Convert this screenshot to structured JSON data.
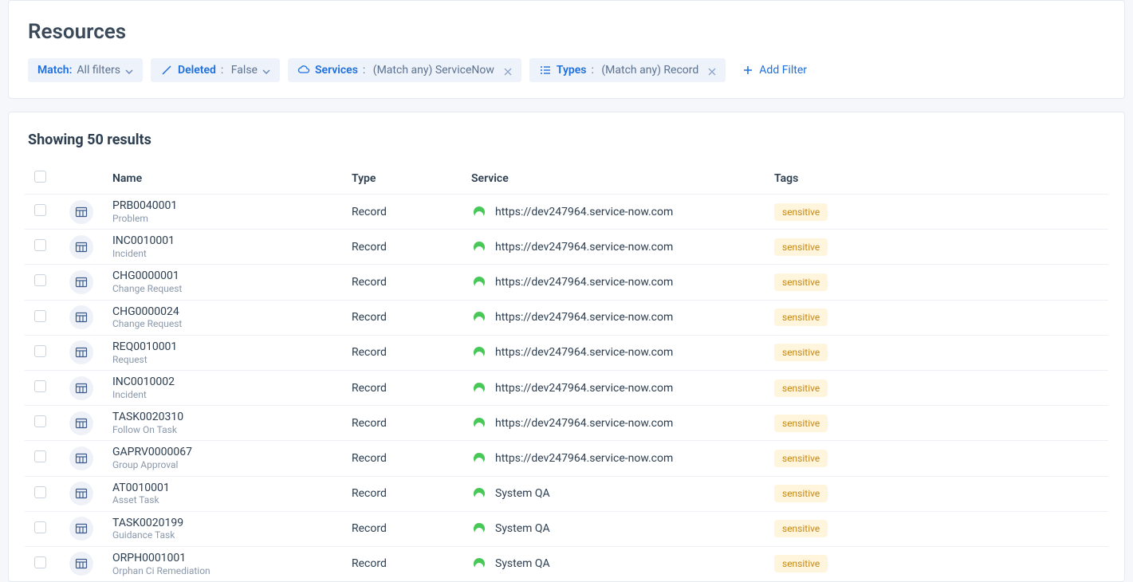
{
  "header": {
    "title": "Resources",
    "filters": {
      "match": {
        "label": "Match:",
        "value": "All filters"
      },
      "deleted": {
        "label": "Deleted",
        "value": "False"
      },
      "services": {
        "label": "Services",
        "value": "(Match any) ServiceNow"
      },
      "types": {
        "label": "Types",
        "value": "(Match any) Record"
      }
    },
    "add_filter_label": "Add Filter"
  },
  "results": {
    "heading": "Showing 50 results",
    "columns": {
      "name": "Name",
      "type": "Type",
      "service": "Service",
      "tags": "Tags"
    },
    "rows": [
      {
        "name": "PRB0040001",
        "sub": "Problem",
        "type": "Record",
        "service": "https://dev247964.service-now.com",
        "tag": "sensitive"
      },
      {
        "name": "INC0010001",
        "sub": "Incident",
        "type": "Record",
        "service": "https://dev247964.service-now.com",
        "tag": "sensitive"
      },
      {
        "name": "CHG0000001",
        "sub": "Change Request",
        "type": "Record",
        "service": "https://dev247964.service-now.com",
        "tag": "sensitive"
      },
      {
        "name": "CHG0000024",
        "sub": "Change Request",
        "type": "Record",
        "service": "https://dev247964.service-now.com",
        "tag": "sensitive"
      },
      {
        "name": "REQ0010001",
        "sub": "Request",
        "type": "Record",
        "service": "https://dev247964.service-now.com",
        "tag": "sensitive"
      },
      {
        "name": "INC0010002",
        "sub": "Incident",
        "type": "Record",
        "service": "https://dev247964.service-now.com",
        "tag": "sensitive"
      },
      {
        "name": "TASK0020310",
        "sub": "Follow On Task",
        "type": "Record",
        "service": "https://dev247964.service-now.com",
        "tag": "sensitive"
      },
      {
        "name": "GAPRV0000067",
        "sub": "Group Approval",
        "type": "Record",
        "service": "https://dev247964.service-now.com",
        "tag": "sensitive"
      },
      {
        "name": "AT0010001",
        "sub": "Asset Task",
        "type": "Record",
        "service": "System QA",
        "tag": "sensitive"
      },
      {
        "name": "TASK0020199",
        "sub": "Guidance Task",
        "type": "Record",
        "service": "System QA",
        "tag": "sensitive"
      },
      {
        "name": "ORPH0001001",
        "sub": "Orphan Ci Remediation",
        "type": "Record",
        "service": "System QA",
        "tag": "sensitive"
      }
    ]
  }
}
